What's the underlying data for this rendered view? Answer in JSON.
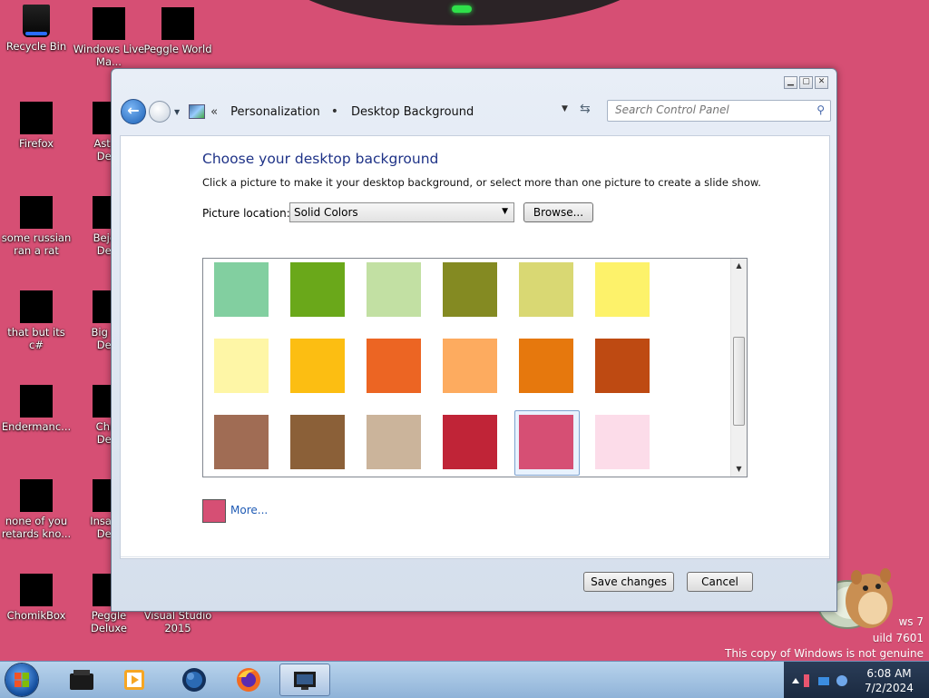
{
  "desktop": {
    "icons": [
      {
        "label": "Recycle Bin"
      },
      {
        "label": "Windows Live\nMa..."
      },
      {
        "label": "Peggle World"
      },
      {
        "label": "Firefox"
      },
      {
        "label": "Astrol\nDelu"
      },
      {
        "label": "some russian\nran a rat"
      },
      {
        "label": "Bejew\nDelu"
      },
      {
        "label": "that but its c#"
      },
      {
        "label": "Big Mo\nDelu"
      },
      {
        "label": "Endermanc..."
      },
      {
        "label": "Chuz\nDelu"
      },
      {
        "label": "none of you\nretards kno..."
      },
      {
        "label": "Insaniq\nDelu"
      },
      {
        "label": "ChomikBox"
      },
      {
        "label": "Peggle Deluxe"
      },
      {
        "label": "Visual Studio\n2015"
      }
    ],
    "watermark": {
      "line1": "ws 7",
      "line2": "uild 7601",
      "line3": "This copy of Windows is not genuine"
    },
    "background_color": "#d64f74"
  },
  "window": {
    "caption_buttons": [
      "minimize",
      "maximize",
      "close"
    ],
    "nav": {
      "chevron": "«",
      "breadcrumb": [
        "Personalization",
        "Desktop Background"
      ],
      "separator": "•",
      "search_placeholder": "Search Control Panel"
    },
    "heading": "Choose your desktop background",
    "subtitle": "Click a picture to make it your desktop background, or select more than one picture to create a slide show.",
    "picture_location_label": "Picture location:",
    "picture_location_value": "Solid Colors",
    "browse_label": "Browse...",
    "swatches": [
      [
        "#82cfa0",
        "#6aa81a",
        "#c2e0a3",
        "#848a22",
        "#d9d873",
        "#fdf26a"
      ],
      [
        "#fef6a6",
        "#fcbe12",
        "#ec6523",
        "#fdab5f",
        "#e6780d",
        "#be4a12"
      ],
      [
        "#a06c54",
        "#8b6038",
        "#cbb49b",
        "#c02437",
        "#d64f74",
        "#fcdce9"
      ]
    ],
    "selected_swatch": {
      "row": 2,
      "col": 4
    },
    "more_label": "More...",
    "save_label": "Save changes",
    "cancel_label": "Cancel"
  },
  "taskbar": {
    "pinned": [
      "explorer",
      "media-player",
      "browser-globe",
      "firefox",
      "control-panel"
    ],
    "active_index": 4,
    "clock": {
      "time": "6:08 AM",
      "date": "7/2/2024"
    }
  }
}
